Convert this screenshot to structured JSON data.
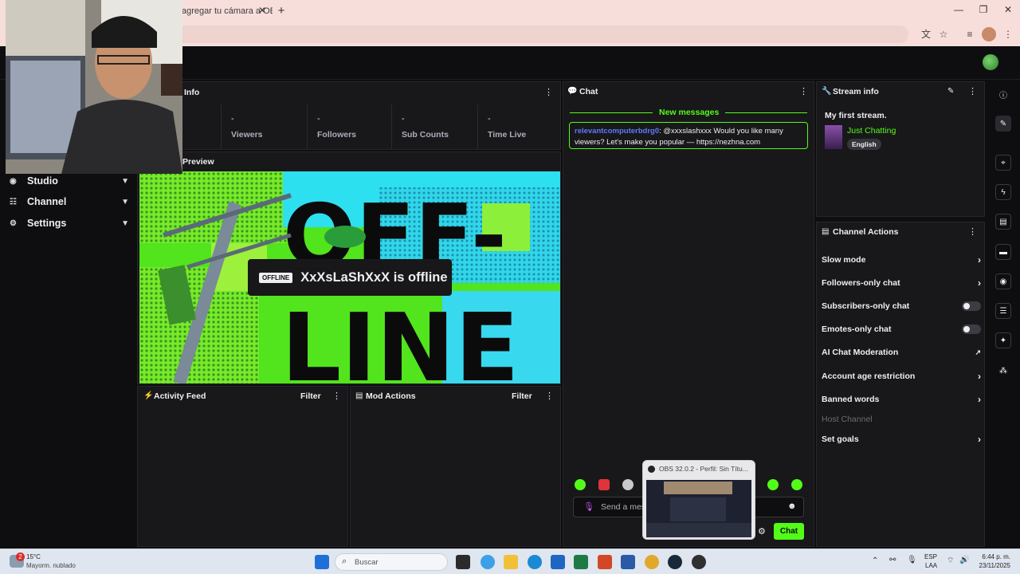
{
  "browser": {
    "tab_title": "agregar tu cámara a OBS",
    "tab_close": "✕",
    "new_tab": "+",
    "minimize": "—",
    "restore": "❐",
    "close": "✕"
  },
  "sidebar": {
    "items": [
      {
        "label": "Studio",
        "icon": "studio-icon"
      },
      {
        "label": "Channel",
        "icon": "channel-icon"
      },
      {
        "label": "Settings",
        "icon": "gear-icon"
      }
    ]
  },
  "info_panel": {
    "title": "Info",
    "stats": [
      {
        "value": "-",
        "label": "Viewers"
      },
      {
        "value": "-",
        "label": "Followers"
      },
      {
        "value": "-",
        "label": "Sub Counts"
      },
      {
        "value": "-",
        "label": "Time Live"
      }
    ]
  },
  "preview": {
    "title": "Preview",
    "badge": "OFFLINE",
    "status": "XxXsLaShXxX is offline",
    "art_text_top": "OFF-",
    "art_text_bottom": "LINE"
  },
  "activity_feed": {
    "title": "Activity Feed",
    "filter": "Filter"
  },
  "mod_actions": {
    "title": "Mod Actions",
    "filter": "Filter"
  },
  "chat": {
    "title": "Chat",
    "new_messages": "New messages",
    "message_user": "relevantcomputerbdrg0",
    "message_text": ": @xxxslashxxx Would you like many viewers? Let's make you popular — https://nezhna.com",
    "input_placeholder": "Send a mes",
    "send_label": "Chat",
    "colors": {
      "accent": "#53fc18",
      "user": "#5c7cfa"
    }
  },
  "stream_info": {
    "title": "Stream info",
    "stream_title": "My first stream.",
    "category": "Just Chatting",
    "tag": "English"
  },
  "channel_actions": {
    "title": "Channel Actions",
    "items": [
      {
        "label": "Slow mode",
        "control": "chevron"
      },
      {
        "label": "Followers-only chat",
        "control": "chevron"
      },
      {
        "label": "Subscribers-only chat",
        "control": "toggle"
      },
      {
        "label": "Emotes-only chat",
        "control": "toggle"
      },
      {
        "label": "AI Chat Moderation",
        "control": "external"
      },
      {
        "label": "Account age restriction",
        "control": "chevron"
      },
      {
        "label": "Banned words",
        "control": "chevron"
      },
      {
        "label": "Host Channel",
        "control": "none",
        "disabled": true
      },
      {
        "label": "Set goals",
        "control": "chevron"
      }
    ]
  },
  "obs_preview": {
    "title": "OBS 32.0.2 - Perfil: Sin Títu..."
  },
  "taskbar": {
    "weather_temp": "15°C",
    "weather_desc": "Mayorm. nublado",
    "weather_badge": "2",
    "search_placeholder": "Buscar",
    "lang_top": "ESP",
    "lang_bottom": "LAA",
    "time": "6:44 p. m.",
    "date": "23/11/2025"
  }
}
